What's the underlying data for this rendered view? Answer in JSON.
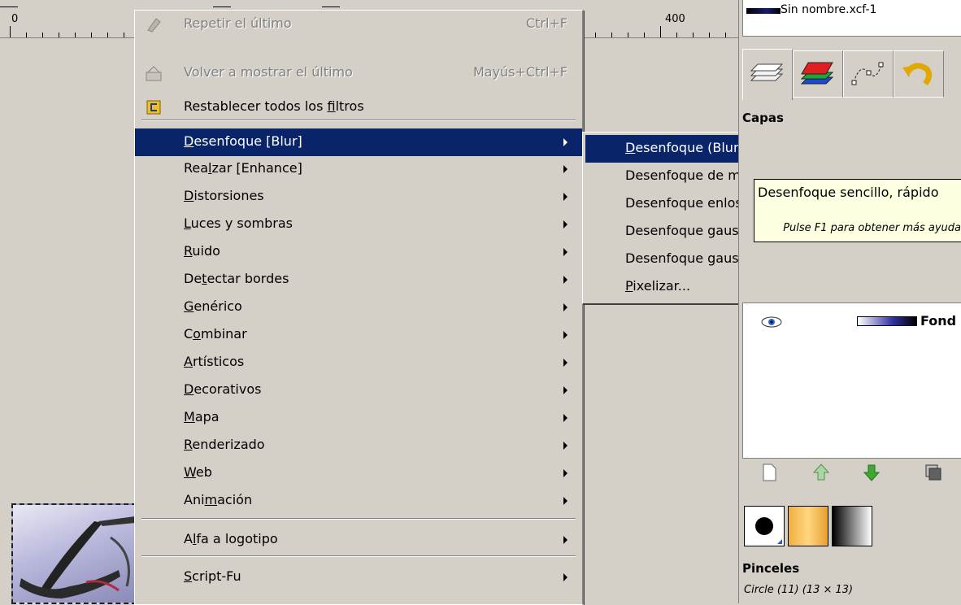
{
  "ruler": {
    "label_0": "0",
    "label_400": "400"
  },
  "image_selector": {
    "name": "Sin nombre.xcf-1"
  },
  "dock": {
    "layers_title": "Capas",
    "layer_name": "Fond",
    "brushes_title": "Pinceles",
    "brush_info": "Circle (11) (13 × 13)",
    "tab_icons": [
      "layers-stack-icon",
      "channels-icon",
      "paths-icon",
      "undo-history-icon"
    ],
    "layer_button_icons": [
      "new-layer-icon",
      "raise-layer-icon",
      "lower-layer-icon",
      "duplicate-layer-icon"
    ]
  },
  "menu": {
    "items": [
      {
        "label": "Repetir el último",
        "accel": "Ctrl+F",
        "disabled": true,
        "icon": "repeat-icon"
      },
      {
        "label": "Volver a mostrar el último",
        "accel": "Mayús+Ctrl+F",
        "disabled": true,
        "icon": "reshow-icon"
      },
      {
        "label": "Restablecer todos los filtros",
        "accel": "",
        "disabled": false,
        "icon": "reset-filters-icon",
        "mnemonic": "f"
      },
      {
        "label": "Desenfoque [Blur]",
        "submenu": true,
        "selected": true,
        "mnemonic": "D"
      },
      {
        "label": "Realzar [Enhance]",
        "submenu": true,
        "mnemonic": "l"
      },
      {
        "label": "Distorsiones",
        "submenu": true,
        "mnemonic": "D"
      },
      {
        "label": "Luces y sombras",
        "submenu": true,
        "mnemonic": "L"
      },
      {
        "label": "Ruido",
        "submenu": true,
        "mnemonic": "R"
      },
      {
        "label": "Detectar bordes",
        "submenu": true,
        "mnemonic": "t"
      },
      {
        "label": "Genérico",
        "submenu": true,
        "mnemonic": "G"
      },
      {
        "label": "Combinar",
        "submenu": true,
        "mnemonic": "o"
      },
      {
        "label": "Artísticos",
        "submenu": true,
        "mnemonic": "A"
      },
      {
        "label": "Decorativos",
        "submenu": true,
        "mnemonic": "D"
      },
      {
        "label": "Mapa",
        "submenu": true,
        "mnemonic": "M"
      },
      {
        "label": "Renderizado",
        "submenu": true,
        "mnemonic": "R"
      },
      {
        "label": "Web",
        "submenu": true,
        "mnemonic": "W"
      },
      {
        "label": "Animación",
        "submenu": true,
        "mnemonic": "m"
      },
      {
        "label": "Alfa a logotipo",
        "submenu": true,
        "mnemonic": "l"
      },
      {
        "label": "Script-Fu",
        "submenu": true,
        "mnemonic": "S"
      }
    ]
  },
  "submenu": {
    "items": [
      {
        "label": "Desenfoque (Blur)",
        "selected": true,
        "mnemonic": "D"
      },
      {
        "label": "Desenfoque de movimiento..."
      },
      {
        "label": "Desenfoque enlosable..."
      },
      {
        "label": "Desenfoque gaussiano selectivo..."
      },
      {
        "label": "Desenfoque gaussiano..."
      },
      {
        "label": "Pixelizar...",
        "mnemonic": "P"
      }
    ]
  },
  "tooltip": {
    "text": "Desenfoque sencillo, rápido",
    "help": "Pulse F1 para obtener más ayuda"
  },
  "colors": {
    "menu_selected": "#0a246a",
    "menu_bg": "#d4d0c8",
    "tooltip_bg": "#ffffe1"
  }
}
